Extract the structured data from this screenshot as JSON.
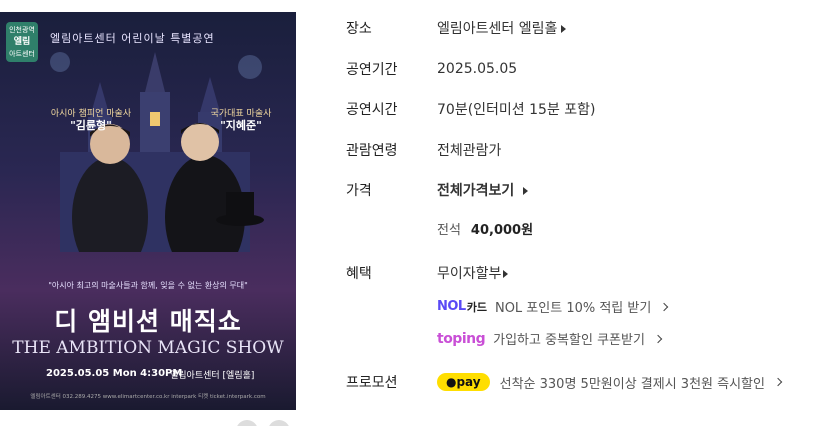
{
  "poster": {
    "tag_line1": "인천광역",
    "tag_line2": "엘림",
    "tag_line3": "아트센터",
    "header": "엘림아트센터 어린이날 특별공연",
    "magician1_title": "아시아 챔피언 마술사",
    "magician1_name": "\"김륜형\"",
    "magician2_title": "국가대표 마술사",
    "magician2_name": "\"지혜준\"",
    "tagline": "\"아시아 최고의 마술사들과 함께, 잊을 수 없는 환상의 무대\"",
    "kor_title": "디 앰비션 매직쇼",
    "eng_title": "THE AMBITION MAGIC SHOW",
    "date": "2025.05.05 Mon 4:30PM",
    "venue": "엘림아트센터 [엘림홀]",
    "footer": "엘림아트센터 032.289.4275  www.elimartcenter.co.kr  interpark 티켓  ticket.interpark.com"
  },
  "info": {
    "venue_label": "장소",
    "venue_value": "엘림아트센터 엘림홀",
    "period_label": "공연기간",
    "period_value": "2025.05.05",
    "time_label": "공연시간",
    "time_value": "70분(인터미션 15분 포함)",
    "age_label": "관람연령",
    "age_value": "전체관람가",
    "price_label": "가격",
    "price_link": "전체가격보기",
    "seat_label": "전석",
    "seat_price": "40,000원",
    "benefit_label": "혜택",
    "benefit_value": "무이자할부",
    "nol_logo": "NOL",
    "nol_card": "카드",
    "nol_text": "NOL 포인트 10% 적립 받기",
    "toping_logo": "toping",
    "toping_text": "가입하고 중복할인 쿠폰받기",
    "promo_label": "프로모션",
    "pay_badge": "●pay",
    "promo_text": "선착순 330명 5만원이상 결제시 3천원 즉시할인"
  }
}
